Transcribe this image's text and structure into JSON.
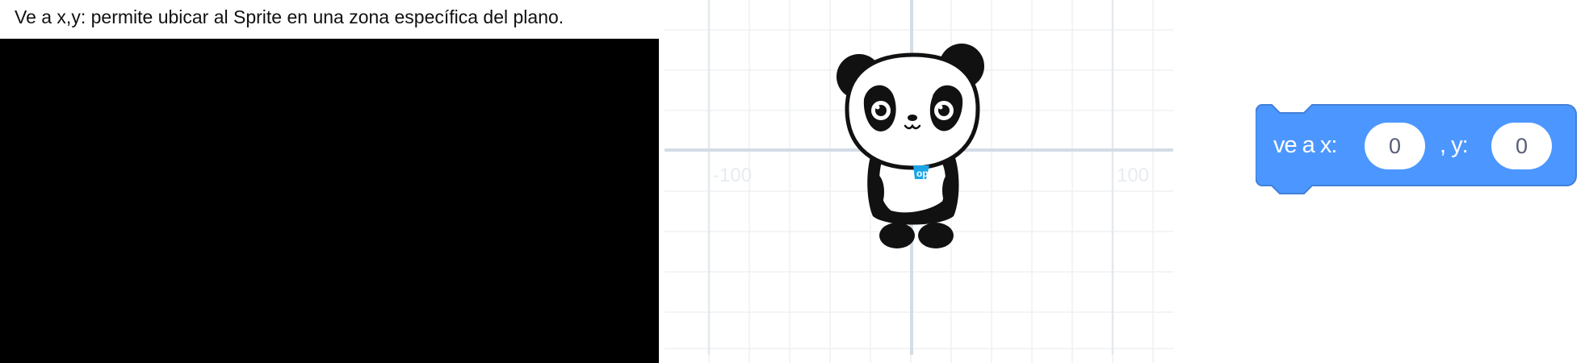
{
  "caption": "Ve a x,y: permite ubicar al Sprite en una zona específica del plano.",
  "stage": {
    "x_tick_neg": "-100",
    "x_tick_pos": "100",
    "sprite_icon": "panda-sprite-icon",
    "grid_color": "#e8ecf0",
    "axis_color": "#d4dde6"
  },
  "block": {
    "label_prefix": "ve a x:",
    "x_value": "0",
    "label_mid": ", y:",
    "y_value": "0",
    "color": "#4c97ff",
    "border_color": "#4280d7"
  },
  "colors": {
    "black_panel": "#000000"
  }
}
